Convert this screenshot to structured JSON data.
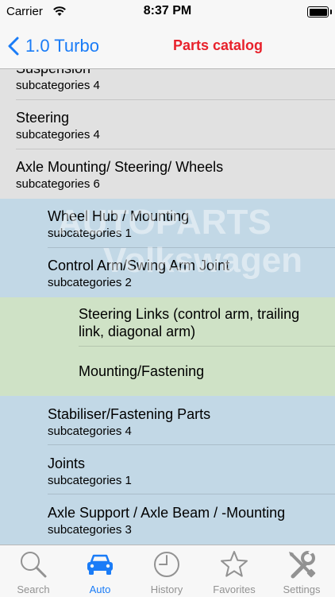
{
  "status_bar": {
    "carrier": "Carrier",
    "time": "8:37 PM"
  },
  "nav": {
    "back_label": "1.0 Turbo",
    "title": "Parts catalog"
  },
  "watermark": {
    "line1": "AUTOPARTS",
    "line2": "Volkswagen"
  },
  "list": {
    "rows": [
      {
        "title": "Suspension",
        "subtitle": "subcategories 4",
        "level": 1
      },
      {
        "title": "Steering",
        "subtitle": "subcategories 4",
        "level": 1
      },
      {
        "title": "Axle Mounting/ Steering/ Wheels",
        "subtitle": "subcategories 6",
        "level": 1
      },
      {
        "title": "Wheel Hub / Mounting",
        "subtitle": "subcategories 1",
        "level": 2
      },
      {
        "title": "Control Arm/Swing Arm Joint",
        "subtitle": "subcategories 2",
        "level": 2
      },
      {
        "title": "Steering Links (control arm, trailing",
        "title2": "link, diagonal arm)",
        "level": 3
      },
      {
        "title": "Mounting/Fastening",
        "level": 3
      },
      {
        "title": "Stabiliser/Fastening Parts",
        "subtitle": "subcategories 4",
        "level": 2
      },
      {
        "title": "Joints",
        "subtitle": "subcategories 1",
        "level": 2
      },
      {
        "title": "Axle Support / Axle Beam / -Mounting",
        "subtitle": "subcategories 3",
        "level": 2
      }
    ]
  },
  "tabs": [
    {
      "label": "Search",
      "icon": "search-icon"
    },
    {
      "label": "Auto",
      "icon": "car-icon",
      "active": true
    },
    {
      "label": "History",
      "icon": "clock-icon"
    },
    {
      "label": "Favorites",
      "icon": "star-icon"
    },
    {
      "label": "Settings",
      "icon": "tools-icon"
    }
  ],
  "colors": {
    "accent": "#1a7cf7",
    "title": "#e8212b",
    "level1": "#e1e1e1",
    "level2": "#c2d8e6",
    "level3": "#cfe2c6"
  }
}
